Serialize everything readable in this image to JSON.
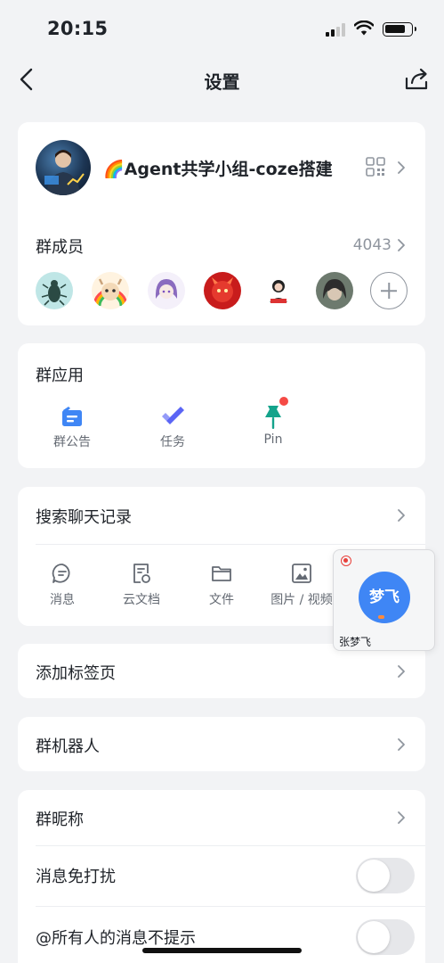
{
  "status_bar": {
    "time": "20:15"
  },
  "nav": {
    "title": "设置"
  },
  "group": {
    "name": "🌈Agent共学小组-coze搭建",
    "members_label": "群成员",
    "members_count": "4043"
  },
  "apps": {
    "title": "群应用",
    "items": [
      {
        "label": "群公告",
        "icon": "announcement-icon"
      },
      {
        "label": "任务",
        "icon": "task-check-icon"
      },
      {
        "label": "Pin",
        "icon": "pin-icon"
      }
    ]
  },
  "history": {
    "title": "搜索聊天记录",
    "items": [
      {
        "label": "消息",
        "icon": "message-icon"
      },
      {
        "label": "云文档",
        "icon": "cloud-doc-icon"
      },
      {
        "label": "文件",
        "icon": "folder-icon"
      },
      {
        "label": "图片 / 视频",
        "icon": "image-icon"
      }
    ]
  },
  "rows": {
    "add_tab": "添加标签页",
    "bots": "群机器人",
    "nickname": "群昵称",
    "mute": "消息免打扰",
    "mention_all": "@所有人的消息不提示"
  },
  "toggles": {
    "mute": false,
    "mention_all": false
  },
  "float_call": {
    "avatar_text": "梦飞",
    "name": "张梦飞"
  },
  "colors": {
    "accent": "#3f86f5",
    "task": "#5b65f5",
    "pin": "#14a38b",
    "badge": "#f54a45"
  }
}
